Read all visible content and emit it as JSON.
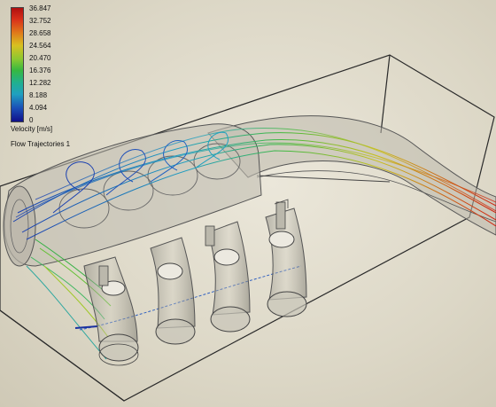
{
  "legend": {
    "ticks": [
      "36.847",
      "32.752",
      "28.658",
      "24.564",
      "20.470",
      "16.376",
      "12.282",
      "8.188",
      "4.094",
      "0"
    ],
    "unit_label": "Velocity [m/s]",
    "caption": "Flow Trajectories 1"
  },
  "colors": {
    "background": "#ddd8c8",
    "streamline_low": "#1a40b0",
    "streamline_mid": "#30b040",
    "streamline_high": "#d02010"
  }
}
